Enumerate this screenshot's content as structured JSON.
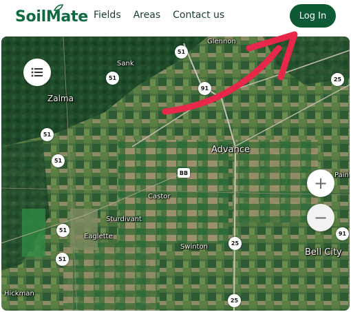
{
  "brand": {
    "name": "SoilMate",
    "color": "#0f6a3f"
  },
  "nav": [
    {
      "label": "Fields"
    },
    {
      "label": "Areas"
    },
    {
      "label": "Contact us"
    }
  ],
  "login": {
    "label": "Log In",
    "color": "#0e5a34"
  },
  "map": {
    "places": {
      "glennon": "Glennon",
      "sank": "Sank",
      "zalma": "Zalma",
      "advance": "Advance",
      "castor": "Castor",
      "sturdivant": "Sturdivant",
      "eaglette": "Eaglette",
      "swinton": "Swinton",
      "bell_city": "Bell City",
      "hickman": "Hickman",
      "paint": "Paint"
    },
    "routes": {
      "r51_a": "51",
      "r51_b": "51",
      "r51_c": "51",
      "r51_d": "51",
      "r51_e": "51",
      "r51_f": "51",
      "r91_a": "91",
      "r91_b": "91",
      "r25_a": "25",
      "r25_b": "25",
      "r25_c": "25",
      "bb": "BB"
    },
    "controls": {
      "zoom_in": "+",
      "zoom_out": "−",
      "list_icon": "list-icon"
    },
    "annotation": {
      "arrow_color": "#e8284a"
    }
  }
}
